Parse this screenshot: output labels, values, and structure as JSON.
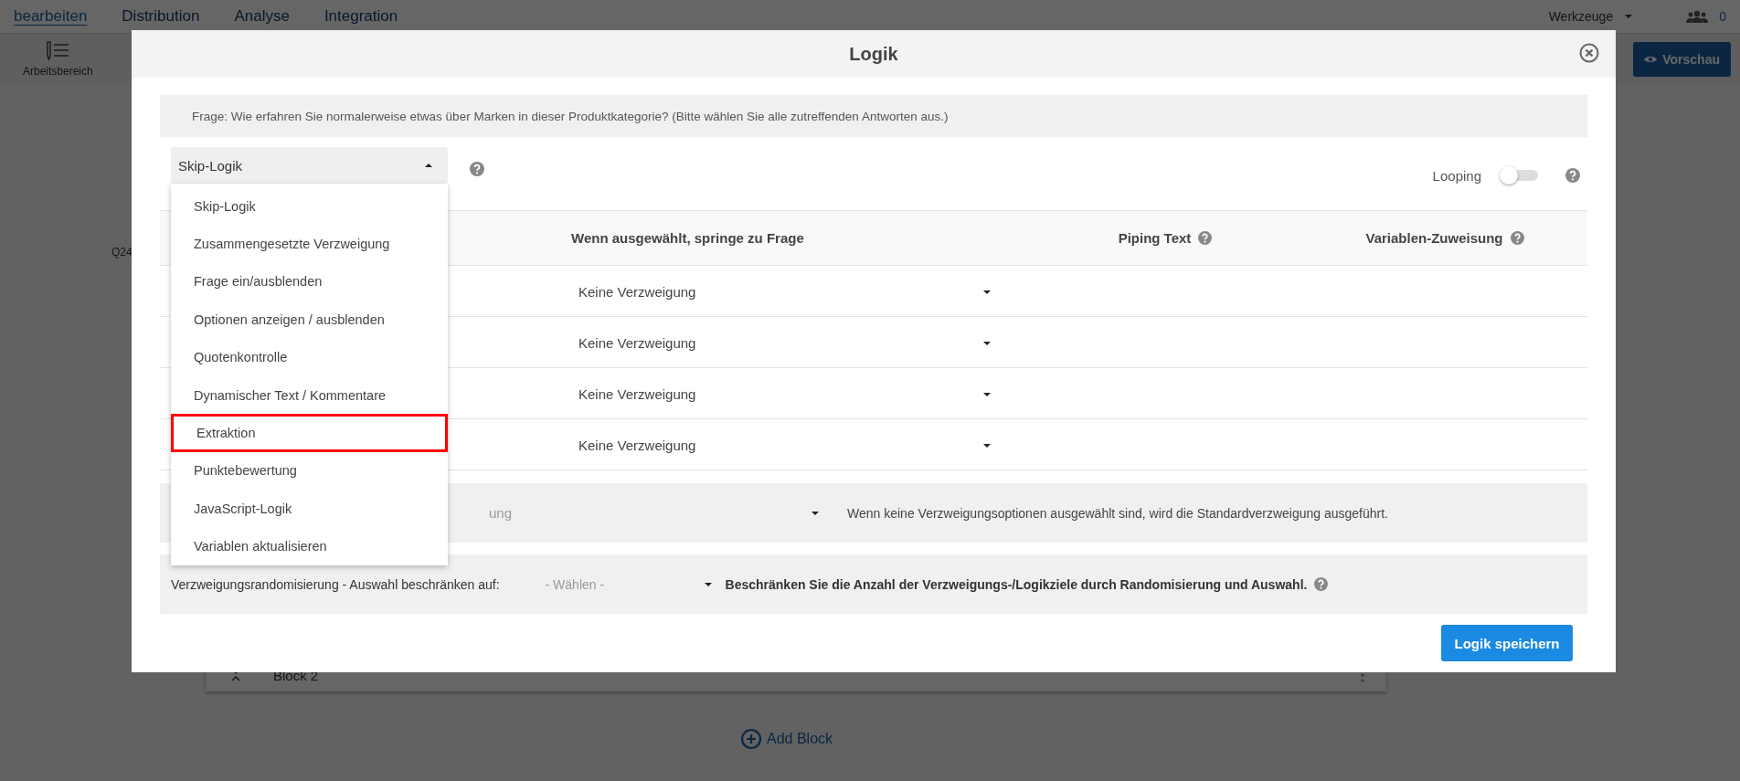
{
  "nav": {
    "tabs": [
      {
        "label": "bearbeiten",
        "selected": true
      },
      {
        "label": "Distribution",
        "selected": false
      },
      {
        "label": "Analyse",
        "selected": false
      },
      {
        "label": "Integration",
        "selected": false
      }
    ],
    "tools": "Werkzeuge",
    "collaborators": "0"
  },
  "toolbar": {
    "workspace": "Arbeitsbereich",
    "preview": "Vorschau"
  },
  "page": {
    "question_number": "Q24",
    "block": "Block 2",
    "add_block": "Add Block"
  },
  "dialog": {
    "title": "Logik",
    "question": "Frage: Wie erfahren Sie normalerweise etwas über Marken in dieser Produktkategorie? (Bitte wählen Sie alle zutreffenden Antworten aus.)",
    "logic_type": "Skip-Logik",
    "menu_open": true,
    "menu": [
      {
        "label": "Skip-Logik",
        "highlighted": false
      },
      {
        "label": "Zusammengesetzte Verzweigung",
        "highlighted": false
      },
      {
        "label": "Frage ein/ausblenden",
        "highlighted": false
      },
      {
        "label": "Optionen anzeigen / ausblenden",
        "highlighted": false
      },
      {
        "label": "Quotenkontrolle",
        "highlighted": false
      },
      {
        "label": "Dynamischer Text / Kommentare",
        "highlighted": false
      },
      {
        "label": "Extraktion",
        "highlighted": true
      },
      {
        "label": "Punktebewertung",
        "highlighted": false
      },
      {
        "label": "JavaScript-Logik",
        "highlighted": false
      },
      {
        "label": "Variablen aktualisieren",
        "highlighted": false
      }
    ],
    "looping": {
      "label": "Looping",
      "on": false
    },
    "columns": [
      "Wenn ausgewählt, springe zu Frage",
      "Piping Text",
      "Variablen-Zuweisung"
    ],
    "rows": [
      {
        "jump": "Keine Verzweigung"
      },
      {
        "jump": "Keine Verzweigung"
      },
      {
        "jump": "Keine Verzweigung"
      },
      {
        "jump": "Keine Verzweigung"
      }
    ],
    "default_branch": {
      "value": "ung",
      "note": "Wenn keine Verzweigungsoptionen ausgewählt sind, wird die Standardverzweigung ausgeführt."
    },
    "randomization": {
      "label": "Verzweigungsrandomisierung - Auswahl beschränken auf:",
      "placeholder": "- Wählen -",
      "note": "Beschränken Sie die Anzahl der Verzweigungs-/Logikziele durch Randomisierung und Auswahl."
    },
    "save": "Logik speichern"
  }
}
